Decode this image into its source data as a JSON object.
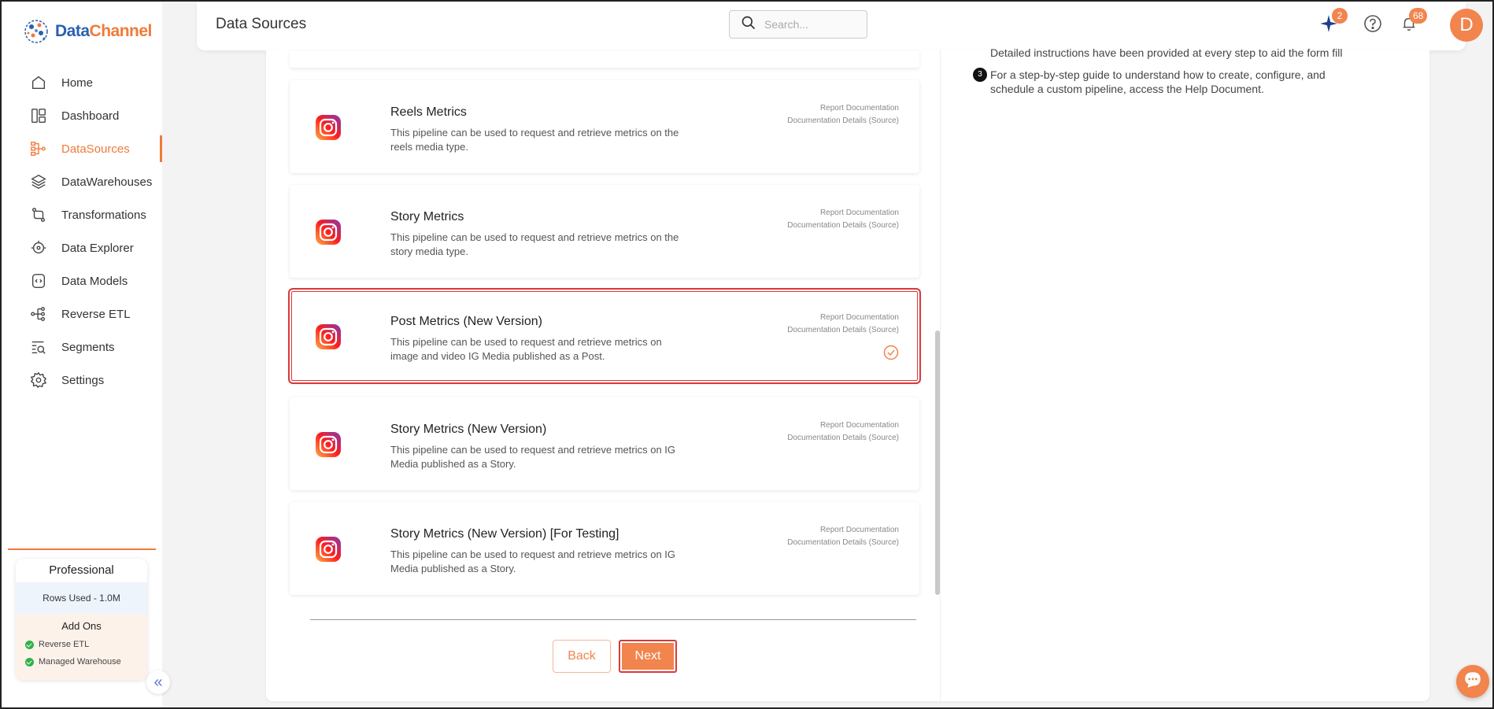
{
  "brand": {
    "name_part1": "Data",
    "name_part2": "Channel"
  },
  "sidebar": {
    "items": [
      {
        "label": "Home",
        "icon": "home-icon"
      },
      {
        "label": "Dashboard",
        "icon": "dashboard-icon"
      },
      {
        "label": "DataSources",
        "icon": "datasources-icon",
        "active": true
      },
      {
        "label": "DataWarehouses",
        "icon": "layers-icon"
      },
      {
        "label": "Transformations",
        "icon": "transform-icon"
      },
      {
        "label": "Data Explorer",
        "icon": "explorer-icon"
      },
      {
        "label": "Data Models",
        "icon": "data-models-icon"
      },
      {
        "label": "Reverse ETL",
        "icon": "reverse-etl-icon"
      },
      {
        "label": "Segments",
        "icon": "segments-icon"
      },
      {
        "label": "Settings",
        "icon": "gear-icon"
      }
    ],
    "plan": {
      "title": "Professional",
      "rows_used": "Rows Used - 1.0M",
      "addons_title": "Add Ons",
      "addons": [
        "Reverse ETL",
        "Managed Warehouse"
      ]
    },
    "collapse_label": "«"
  },
  "header": {
    "title": "Data Sources",
    "search_placeholder": "Search...",
    "sparkle_badge": "2",
    "notification_badge": "68",
    "avatar_initial": "D"
  },
  "cards": [
    {
      "title": "Reels Metrics",
      "description": "This pipeline can be used to request and retrieve metrics on the reels media type.",
      "link1": "Report Documentation",
      "link2": "Documentation Details (Source)"
    },
    {
      "title": "Story Metrics",
      "description": "This pipeline can be used to request and retrieve metrics on the story media type.",
      "link1": "Report Documentation",
      "link2": "Documentation Details (Source)"
    },
    {
      "title": "Post Metrics (New Version)",
      "description": "This pipeline can be used to request and retrieve metrics on image and video IG Media published as a Post.",
      "link1": "Report Documentation",
      "link2": "Documentation Details (Source)",
      "selected": true
    },
    {
      "title": "Story Metrics (New Version)",
      "description": "This pipeline can be used to request and retrieve metrics on IG Media published as a Story.",
      "link1": "Report Documentation",
      "link2": "Documentation Details (Source)"
    },
    {
      "title": "Story Metrics (New Version) [For Testing]",
      "description": "This pipeline can be used to request and retrieve metrics on IG Media published as a Story.",
      "link1": "Report Documentation",
      "link2": "Documentation Details (Source)"
    }
  ],
  "buttons": {
    "back": "Back",
    "next": "Next"
  },
  "instructions": {
    "partial_line": "Detailed instructions have been provided at every step to aid the form fill",
    "step3_number": "3",
    "step3_text": "For a step-by-step guide to understand how to create, configure, and schedule a custom pipeline, access the Help Document."
  },
  "colors": {
    "accent": "#f2844d",
    "selected_outline": "#d93a3a",
    "brand_blue": "#2b5fb0"
  }
}
